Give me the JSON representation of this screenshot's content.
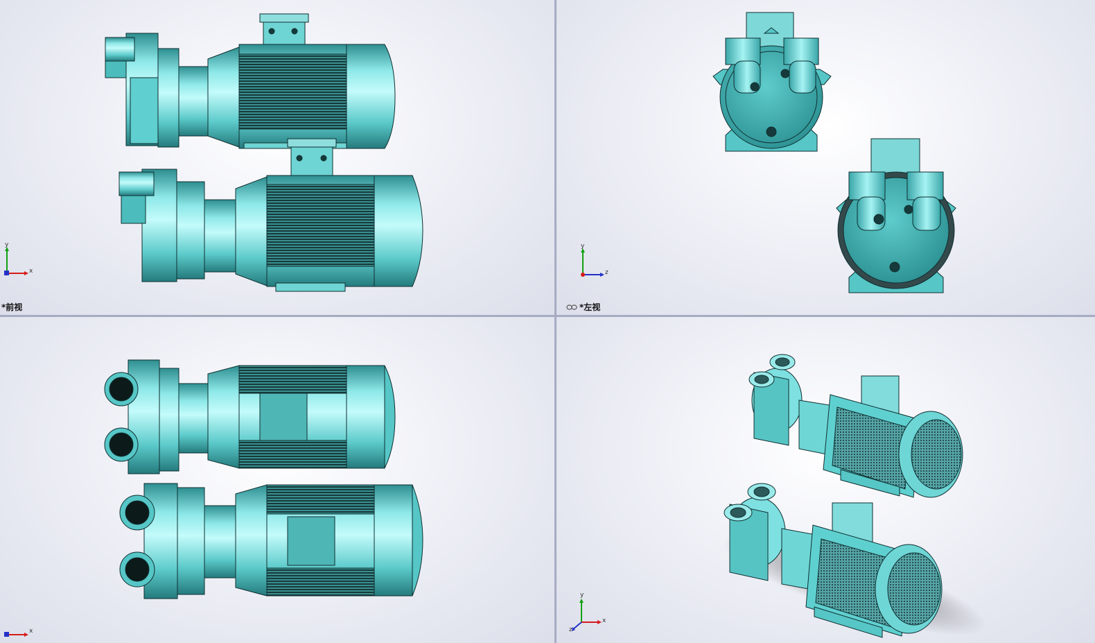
{
  "viewports": {
    "front": {
      "label": "*前视",
      "axis_h": "x",
      "axis_v": "y"
    },
    "left": {
      "label": "*左视",
      "axis_h": "z",
      "axis_v": "y"
    },
    "top": {
      "axis_h": "x",
      "axis_v": "z"
    },
    "iso": {
      "axis_h": "x",
      "axis_v": "y",
      "axis_d": "z"
    }
  },
  "colors": {
    "body": "#56c6c6",
    "body_light": "#a8f0f0",
    "body_dark": "#2d8d90",
    "outline": "#0f2f31",
    "fins": "#1b3f40",
    "background": "#eef0f6",
    "divider": "#a7abc2"
  }
}
